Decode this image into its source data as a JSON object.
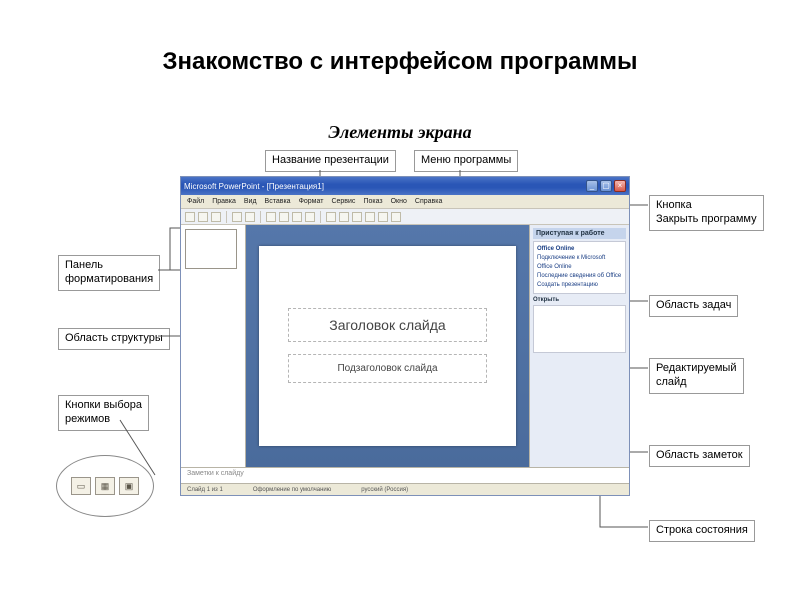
{
  "page": {
    "title": "Знакомство с интерфейсом программы",
    "subtitle": "Элементы экрана"
  },
  "labels": {
    "presentation_name": "Название презентации",
    "program_menu": "Меню программы",
    "close_button": "Кнопка\nЗакрыть программу",
    "formatting_panel": "Панель\nформатирования",
    "outline_area": "Область  структуры",
    "view_buttons": "Кнопки выбора\nрежимов",
    "task_pane": "Область задач",
    "editable_slide": "Редактируемый\nслайд",
    "notes_area": "Область заметок",
    "status_bar": "Строка состояния"
  },
  "window": {
    "title": "Microsoft PowerPoint - [Презентация1]",
    "menu": [
      "Файл",
      "Правка",
      "Вид",
      "Вставка",
      "Формат",
      "Сервис",
      "Показ",
      "Окно",
      "Справка"
    ],
    "slide_title_placeholder": "Заголовок слайда",
    "slide_subtitle_placeholder": "Подзаголовок слайда",
    "taskpane": {
      "header": "Приступая к работе",
      "office_online": "Office Online",
      "section_open": "Открыть",
      "items": [
        "Подключение к Microsoft Office Online",
        "Последние сведения об Office",
        "Создать презентацию"
      ]
    },
    "notes_hint": "Заметки к слайду",
    "status": {
      "slide": "Слайд 1 из 1",
      "template": "Оформление по умолчанию",
      "lang": "русский (Россия)"
    }
  }
}
